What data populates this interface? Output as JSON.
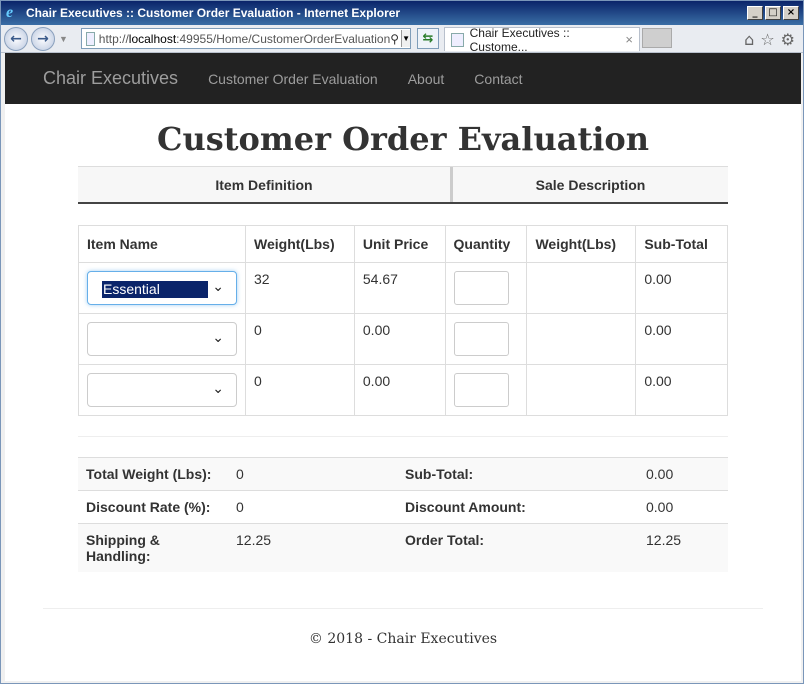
{
  "window": {
    "title": "Chair Executives :: Customer Order Evaluation - Internet Explorer",
    "controls": [
      "_",
      "□",
      "×"
    ]
  },
  "browser": {
    "url_prefix": "http://",
    "url_host": "localhost",
    "url_rest": ":49955/Home/CustomerOrderEvaluation",
    "tab_title": "Chair Executives :: Custome...",
    "tab_close": "×"
  },
  "navbar": {
    "brand": "Chair Executives",
    "links": [
      "Customer Order Evaluation",
      "About",
      "Contact"
    ]
  },
  "page_title": "Customer Order Evaluation",
  "tabs": [
    "Item Definition",
    "Sale Description"
  ],
  "items_table": {
    "headers": [
      "Item Name",
      "Weight(Lbs)",
      "Unit Price",
      "Quantity",
      "Weight(Lbs)",
      "Sub-Total"
    ],
    "rows": [
      {
        "item": "Essential",
        "weight": "32",
        "unit_price": "54.67",
        "quantity": "",
        "total_weight": "",
        "subtotal": "0.00"
      },
      {
        "item": "",
        "weight": "0",
        "unit_price": "0.00",
        "quantity": "",
        "total_weight": "",
        "subtotal": "0.00"
      },
      {
        "item": "",
        "weight": "0",
        "unit_price": "0.00",
        "quantity": "",
        "total_weight": "",
        "subtotal": "0.00"
      }
    ]
  },
  "summary": {
    "total_weight_label": "Total Weight (Lbs):",
    "total_weight": "0",
    "subtotal_label": "Sub-Total:",
    "subtotal": "0.00",
    "discount_rate_label": "Discount Rate (%):",
    "discount_rate": "0",
    "discount_amount_label": "Discount Amount:",
    "discount_amount": "0.00",
    "shipping_label_1": "Shipping &",
    "shipping_label_2": "Handling:",
    "shipping": "12.25",
    "order_total_label": "Order Total:",
    "order_total": "12.25"
  },
  "footer": "© 2018 - Chair Executives"
}
